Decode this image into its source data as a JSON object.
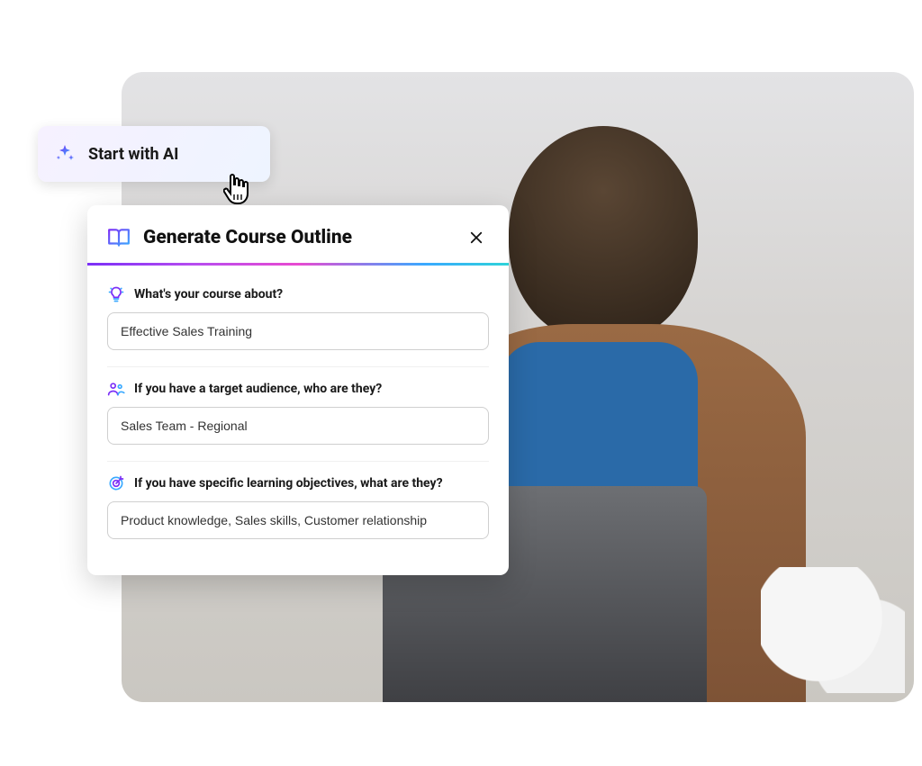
{
  "start_button": {
    "label": "Start with AI",
    "icon": "sparkle-icon"
  },
  "modal": {
    "title": "Generate Course Outline",
    "header_icon": "book-open-icon",
    "close_icon": "close-icon",
    "fields": [
      {
        "icon": "lightbulb-icon",
        "label": "What's your course about?",
        "value": "Effective Sales Training"
      },
      {
        "icon": "people-icon",
        "label": "If you have a target audience, who are they?",
        "value": "Sales Team - Regional"
      },
      {
        "icon": "target-icon",
        "label": "If you have specific learning objectives, what are they?",
        "value": "Product knowledge, Sales skills, Customer relationship"
      }
    ]
  },
  "colors": {
    "gradient_start": "#7b2ff7",
    "gradient_end": "#2ed3d9",
    "accent_purple": "#6b3df5",
    "accent_blue": "#2a8bff"
  }
}
